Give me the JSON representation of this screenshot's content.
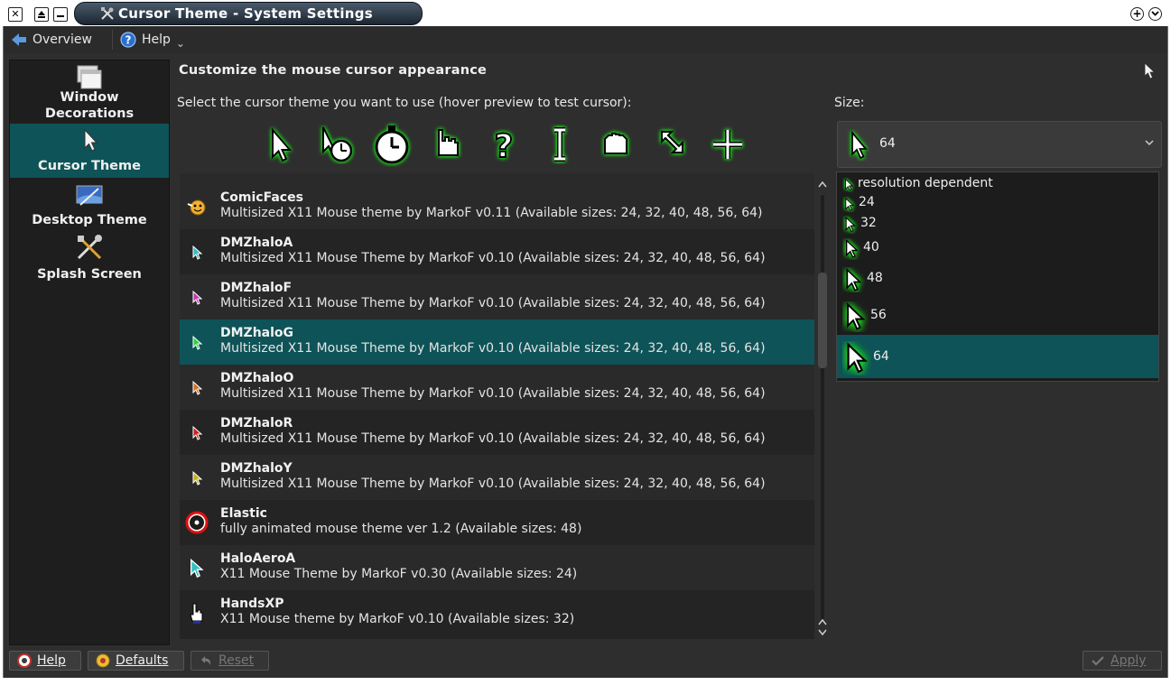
{
  "window": {
    "title": "Cursor Theme - System Settings",
    "close_symbol": "✕",
    "right_buttons": [
      "+",
      "⌄"
    ]
  },
  "toolbar": {
    "overview_label": "Overview",
    "help_label": "Help",
    "help_dropdown": "⌄"
  },
  "sidebar": {
    "items": [
      {
        "label_line1": "Window",
        "label_line2": "Decorations",
        "icon": "window-decorations-icon",
        "active": false
      },
      {
        "label": "Cursor Theme",
        "icon": "cursor-arrow-icon",
        "active": true
      },
      {
        "label": "Desktop Theme",
        "icon": "desktop-theme-icon",
        "active": false
      },
      {
        "label": "Splash Screen",
        "icon": "tools-icon",
        "active": false
      }
    ]
  },
  "main": {
    "heading": "Customize the mouse cursor appearance",
    "instruction": "Select the cursor theme you want to use (hover preview to test cursor):",
    "size_label": "Size:",
    "preview_icons": [
      "arrow-cursor-icon",
      "busy-arrow-cursor-icon",
      "wait-cursor-icon",
      "hand-pointer-icon",
      "help-question-icon",
      "text-ibeam-icon",
      "grab-hand-icon",
      "resize-diagonal-icon",
      "crosshair-icon"
    ]
  },
  "themes": [
    {
      "name": "ComicFaces",
      "desc": "Multisized X11 Mouse theme by MarkoF v0.11 (Available sizes: 24, 32, 40, 48, 56, 64)",
      "icon_color": "#f0b030"
    },
    {
      "name": "DMZhaloA",
      "desc": "Multisized X11 Mouse Theme by MarkoF v0.10 (Available sizes: 24, 32, 40, 48, 56, 64)",
      "icon_color": "#3ab7c6"
    },
    {
      "name": "DMZhaloF",
      "desc": "Multisized X11 Mouse Theme by MarkoF v0.10 (Available sizes: 24, 32, 40, 48, 56, 64)",
      "icon_color": "#c03ab0"
    },
    {
      "name": "DMZhaloG",
      "desc": "Multisized X11 Mouse Theme by MarkoF v0.10 (Available sizes: 24, 32, 40, 48, 56, 64)",
      "icon_color": "#30d040",
      "selected": true
    },
    {
      "name": "DMZhaloO",
      "desc": "Multisized X11 Mouse Theme by MarkoF v0.10 (Available sizes: 24, 32, 40, 48, 56, 64)",
      "icon_color": "#d07020"
    },
    {
      "name": "DMZhaloR",
      "desc": "Multisized X11 Mouse Theme by MarkoF v0.10 (Available sizes: 24, 32, 40, 48, 56, 64)",
      "icon_color": "#d02020"
    },
    {
      "name": "DMZhaloY",
      "desc": "Multisized X11 Mouse Theme by MarkoF v0.10 (Available sizes: 24, 32, 40, 48, 56, 64)",
      "icon_color": "#c0b020"
    },
    {
      "name": "Elastic",
      "desc": "fully animated mouse theme ver 1.2 (Available sizes: 48)",
      "icon_color": "#e01010"
    },
    {
      "name": "HaloAeroA",
      "desc": "X11 Mouse Theme by MarkoF v0.30 (Available sizes: 24)",
      "icon_color": "#30c0c0"
    },
    {
      "name": "HandsXP",
      "desc": "X11 Mouse theme by MarkoF v0.10 (Available sizes: 32)",
      "icon_color": "#ffffff"
    }
  ],
  "size": {
    "current": "64",
    "options": [
      "resolution dependent",
      "24",
      "32",
      "40",
      "48",
      "56",
      "64"
    ],
    "selected_index": 6
  },
  "buttons": {
    "help": "Help",
    "defaults": "Defaults",
    "reset": "Reset",
    "apply": "Apply"
  },
  "colors": {
    "accent": "#0e5357",
    "glow": "#22cc22"
  }
}
